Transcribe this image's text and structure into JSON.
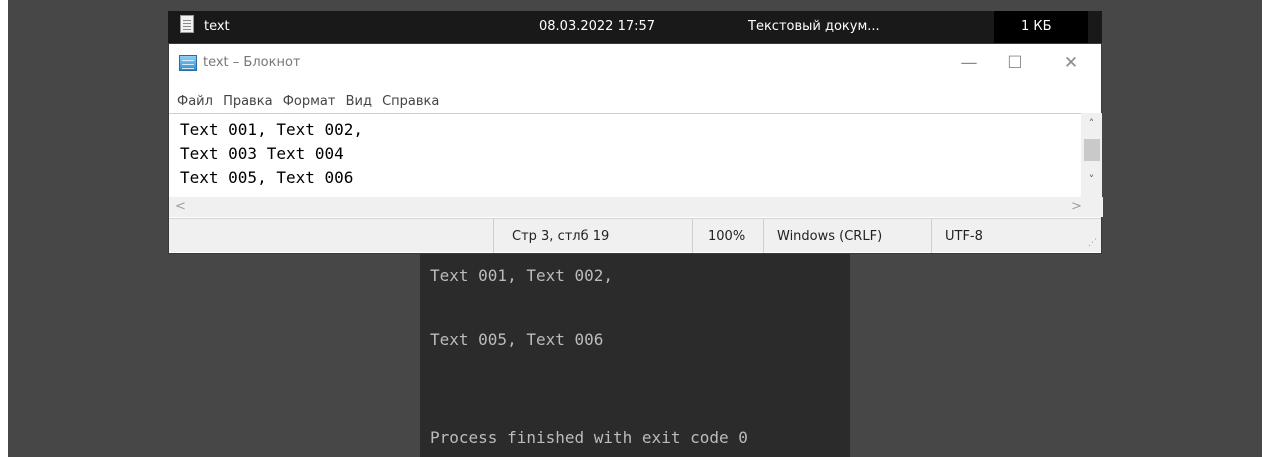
{
  "explorer": {
    "file_name": "text",
    "modified": "08.03.2022 17:57",
    "type": "Текстовый докум...",
    "size": "1 КБ",
    "icon": "text-file-icon"
  },
  "notepad": {
    "title": "text – Блокнот",
    "icon": "notepad-icon",
    "window_buttons": {
      "minimize": "—",
      "maximize": "☐",
      "close": "✕"
    },
    "menu": [
      "Файл",
      "Правка",
      "Формат",
      "Вид",
      "Справка"
    ],
    "lines": [
      "Text 001, Text 002,",
      "Text 003 Text 004",
      "Text 005, Text 006"
    ],
    "scroll_up": "˄",
    "scroll_down": "˅",
    "scroll_left": "<",
    "scroll_right": ">",
    "status": {
      "position": "Стр 3, стлб 19",
      "zoom": "100%",
      "line_ending": "Windows (CRLF)",
      "encoding": "UTF-8"
    }
  },
  "console": {
    "lines": [
      "Text 001, Text 002,",
      "Text 005, Text 006",
      "Process finished with exit code 0"
    ]
  },
  "colors": {
    "background": "#474747",
    "explorer_row": "#191919",
    "console_bg": "#2b2b2b",
    "console_text": "#bbbbbb"
  }
}
